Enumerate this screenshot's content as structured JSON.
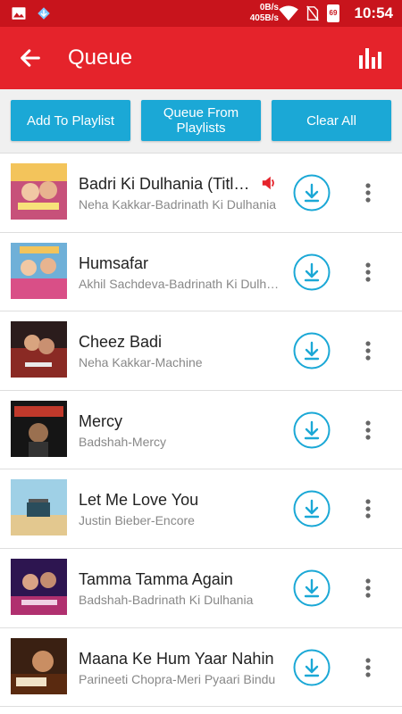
{
  "status_bar": {
    "net_up": "0B/s",
    "net_down": "405B/s",
    "battery": "69",
    "time": "10:54",
    "icons": [
      "gallery-icon",
      "download-app-icon",
      "wifi-icon",
      "no-sim-icon",
      "battery-icon"
    ]
  },
  "app_bar": {
    "title": "Queue",
    "back_icon": "arrow-back-icon",
    "equalizer_icon": "equalizer-icon",
    "color": "#e5232b"
  },
  "actions": {
    "add_to_playlist": "Add To Playlist",
    "queue_from_playlists": "Queue From Playlists",
    "clear_all": "Clear All",
    "button_color": "#1ba8d6"
  },
  "songs": [
    {
      "title": "Badri Ki Dulhania (Title Track)",
      "subtitle": "Neha Kakkar-Badrinath Ki Dulhania",
      "now_playing": true
    },
    {
      "title": "Humsafar",
      "subtitle": "Akhil Sachdeva-Badrinath Ki Dulhania",
      "now_playing": false
    },
    {
      "title": "Cheez Badi",
      "subtitle": "Neha Kakkar-Machine",
      "now_playing": false
    },
    {
      "title": "Mercy",
      "subtitle": "Badshah-Mercy",
      "now_playing": false
    },
    {
      "title": "Let Me Love You",
      "subtitle": "Justin Bieber-Encore",
      "now_playing": false
    },
    {
      "title": "Tamma Tamma Again",
      "subtitle": "Badshah-Badrinath Ki Dulhania",
      "now_playing": false
    },
    {
      "title": "Maana Ke Hum Yaar Nahin",
      "subtitle": "Parineeti Chopra-Meri Pyaari Bindu",
      "now_playing": false
    }
  ],
  "accent_color": "#1ba8d6",
  "now_playing_color": "#e5232b"
}
